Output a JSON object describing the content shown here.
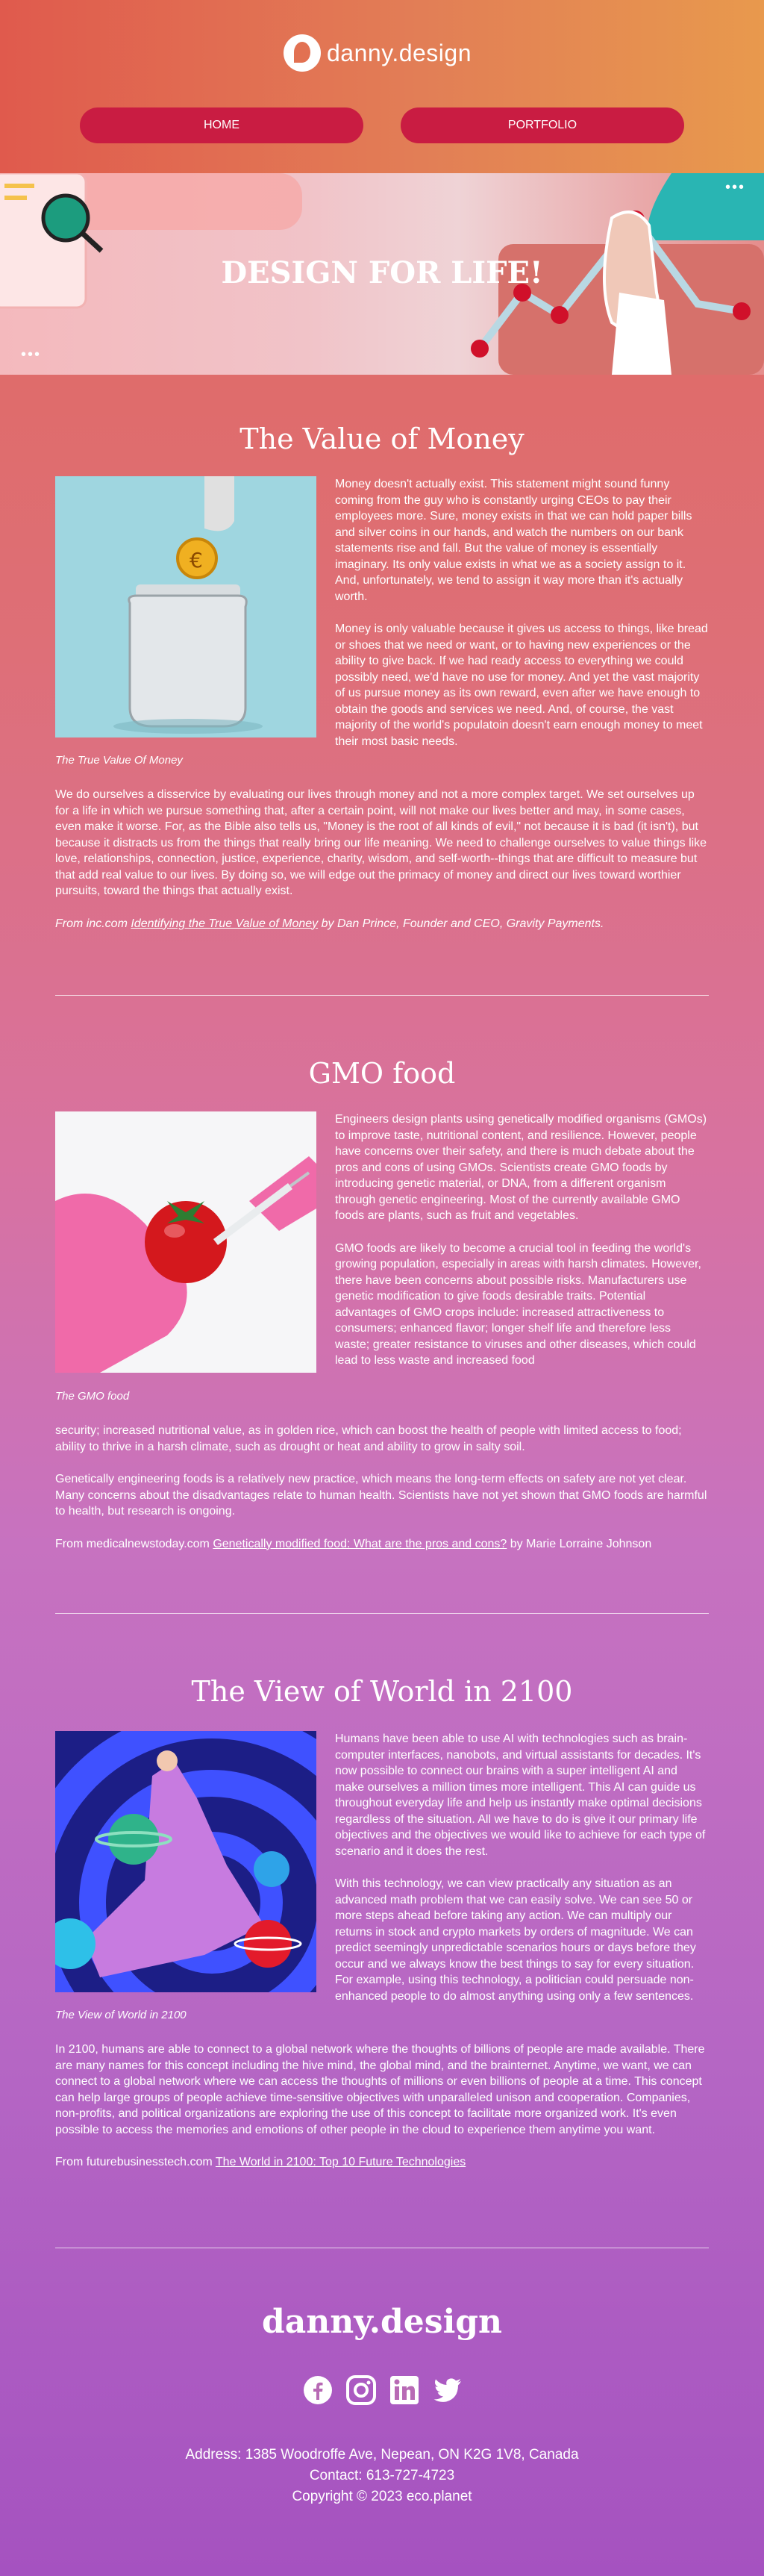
{
  "header": {
    "logo_text": "danny.design",
    "nav": {
      "home": "HOME",
      "portfolio": "PORTFOLIO"
    }
  },
  "hero": {
    "title": "DESIGN FOR LIFE!"
  },
  "sections": [
    {
      "title": "The Value of Money",
      "caption": "The True Value Of Money",
      "right": [
        "Money doesn't actually exist. This statement might sound funny coming from the guy who is constantly urging CEOs to pay their employees more. Sure, money exists in that we can hold paper bills and silver coins in our hands, and watch the numbers on our bank statements rise and fall. But the value of money is essentially imaginary. Its only value exists in what we as a society assign to it. And, unfortunately, we tend to assign it way more than it's actually worth.",
        "Money is only valuable because it gives us access to things, like bread or shoes that we need or want, or to having new experiences or the ability to give back. If we had ready access to everything we could possibly need, we'd have no use for money. And yet the vast majority of us pursue money as its own reward, even after we have enough to obtain the goods and services we need. And, of course, the vast majority of the world's populatoin doesn't earn enough money to meet their most basic needs."
      ],
      "full": [
        "We do ourselves a disservice by evaluating our lives through money and not a more complex target. We set ourselves up for a life in which we pursue something that, after a certain point, will not make our lives better and may, in some cases, even make it worse. For, as the Bible also tells us, \"Money is the root of all kinds of evil,\" not because it is bad (it isn't), but because it distracts us from the things that really bring our life meaning. We need to challenge ourselves to value things like love, relationships, connection, justice, experience, charity, wisdom, and self-worth--things that are difficult to measure but that add real value to our lives. By doing so, we will edge out the primacy of money and direct our lives toward worthier pursuits, toward the things that actually exist."
      ],
      "source_prefix": "From inc.com ",
      "source_link": "Identifying the True Value of Money",
      "source_suffix": " by Dan Prince, Founder and CEO, Gravity Payments."
    },
    {
      "title": "GMO food",
      "caption": "The GMO food",
      "right": [
        "Engineers design plants using genetically modified organisms (GMOs) to improve taste, nutritional content, and resilience. However, people have concerns over their safety, and there is much debate about the pros and cons of using GMOs. Scientists create GMO foods by introducing genetic material, or DNA, from a different organism through genetic engineering. Most of the currently available GMO foods are plants, such as fruit and vegetables.",
        "GMO foods are likely to become a crucial tool in feeding the world's growing population, especially in areas with harsh climates. However, there have been concerns about possible risks. Manufacturers use genetic modification to give foods desirable traits. Potential advantages of GMO crops include: increased attractiveness to consumers; enhanced flavor; longer shelf life and therefore less waste; greater resistance to viruses and other diseases, which could lead to less waste and increased food"
      ],
      "full": [
        "security; increased nutritional value, as in golden rice, which can boost the health of people with limited access to food; ability to thrive in a harsh climate, such as drought or heat and ability to grow in salty soil.",
        "Genetically engineering foods is a relatively new practice, which means the long-term effects on safety are not yet clear. Many concerns about the disadvantages relate to human health. Scientists have not yet shown that GMO foods are harmful to health, but research is ongoing."
      ],
      "source_prefix": "From medicalnewstoday.com ",
      "source_link": "Genetically modified food: What are the pros and cons?",
      "source_suffix": " by Marie Lorraine Johnson"
    },
    {
      "title": "The View of World in 2100",
      "caption": "The View of World in 2100",
      "right": [
        "Humans have been able to use AI with technologies such as brain-computer interfaces, nanobots, and virtual assistants for decades. It's now possible to connect our brains with a super intelligent AI and make ourselves a million times more intelligent. This AI can guide us throughout everyday life and help us instantly make optimal decisions regardless of the situation. All we have to do is give it our primary life objectives and the objectives we would like to achieve for each type of scenario and it does the rest.",
        "With this technology, we can view practically any situation as an advanced math problem that we can easily solve. We can see 50 or more steps ahead before taking any action. We can multiply our returns in stock and crypto markets by orders of magnitude. We can predict seemingly unpredictable scenarios hours or days before they occur and we always know the best things to say for every situation. For example, using this technology, a politician could persuade non-enhanced people to do almost anything using only a few sentences."
      ],
      "full": [
        "In 2100, humans are able to connect to a global network where the thoughts of billions of people are made available. There are many names for this concept including the hive mind, the global mind, and the brainternet. Anytime, we want, we can connect to a global network where we can access the thoughts of millions or even billions of people at a time. This concept can help large groups of people achieve time-sensitive objectives with unparalleled unison and cooperation. Companies, non-profits, and political organizations are exploring the use of this concept to facilitate more organized work. It's even possible to access the memories and emotions of other people in the cloud to experience them anytime you want."
      ],
      "source_prefix": "From futurebusinesstech.com ",
      "source_link": "The World in 2100: Top 10 Future Technologies",
      "source_suffix": ""
    }
  ],
  "footer": {
    "brand": "danny.design",
    "socials": [
      "facebook-icon",
      "instagram-icon",
      "linkedin-icon",
      "twitter-icon"
    ],
    "address": "Address: 1385 Woodroffe Ave, Nepean, ON K2G 1V8, Canada",
    "contact": "Contact: 613-727-4723",
    "copyright": "Copyright © 2023 eco.planet"
  }
}
